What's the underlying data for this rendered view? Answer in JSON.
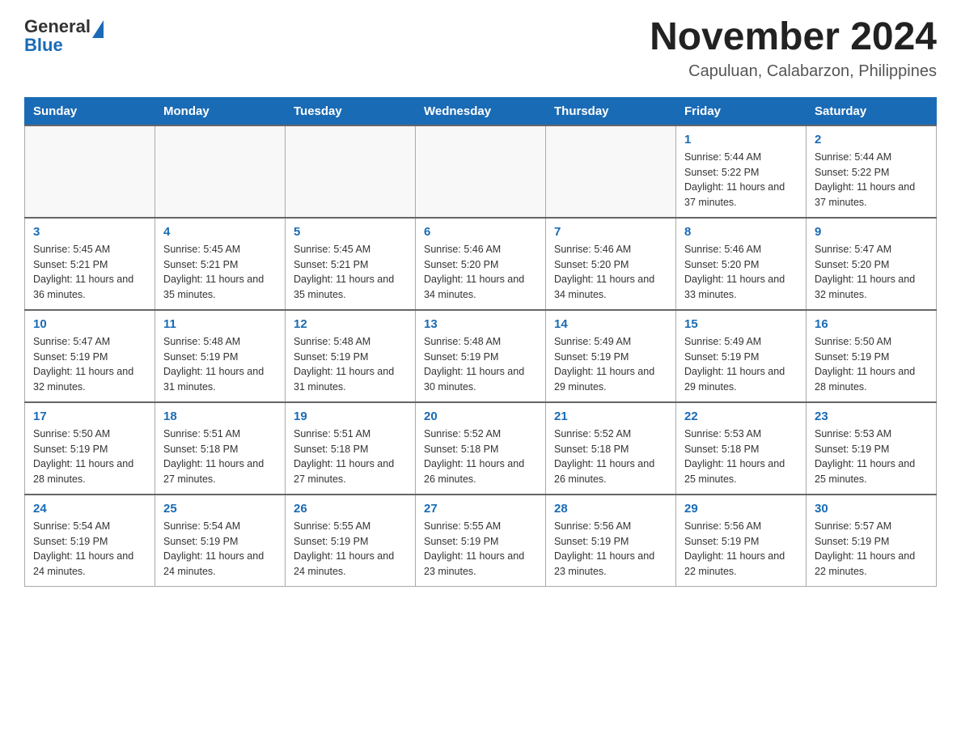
{
  "header": {
    "logo_general": "General",
    "logo_blue": "Blue",
    "title": "November 2024",
    "subtitle": "Capuluan, Calabarzon, Philippines"
  },
  "days_of_week": [
    "Sunday",
    "Monday",
    "Tuesday",
    "Wednesday",
    "Thursday",
    "Friday",
    "Saturday"
  ],
  "weeks": [
    [
      {
        "day": "",
        "info": ""
      },
      {
        "day": "",
        "info": ""
      },
      {
        "day": "",
        "info": ""
      },
      {
        "day": "",
        "info": ""
      },
      {
        "day": "",
        "info": ""
      },
      {
        "day": "1",
        "info": "Sunrise: 5:44 AM\nSunset: 5:22 PM\nDaylight: 11 hours and 37 minutes."
      },
      {
        "day": "2",
        "info": "Sunrise: 5:44 AM\nSunset: 5:22 PM\nDaylight: 11 hours and 37 minutes."
      }
    ],
    [
      {
        "day": "3",
        "info": "Sunrise: 5:45 AM\nSunset: 5:21 PM\nDaylight: 11 hours and 36 minutes."
      },
      {
        "day": "4",
        "info": "Sunrise: 5:45 AM\nSunset: 5:21 PM\nDaylight: 11 hours and 35 minutes."
      },
      {
        "day": "5",
        "info": "Sunrise: 5:45 AM\nSunset: 5:21 PM\nDaylight: 11 hours and 35 minutes."
      },
      {
        "day": "6",
        "info": "Sunrise: 5:46 AM\nSunset: 5:20 PM\nDaylight: 11 hours and 34 minutes."
      },
      {
        "day": "7",
        "info": "Sunrise: 5:46 AM\nSunset: 5:20 PM\nDaylight: 11 hours and 34 minutes."
      },
      {
        "day": "8",
        "info": "Sunrise: 5:46 AM\nSunset: 5:20 PM\nDaylight: 11 hours and 33 minutes."
      },
      {
        "day": "9",
        "info": "Sunrise: 5:47 AM\nSunset: 5:20 PM\nDaylight: 11 hours and 32 minutes."
      }
    ],
    [
      {
        "day": "10",
        "info": "Sunrise: 5:47 AM\nSunset: 5:19 PM\nDaylight: 11 hours and 32 minutes."
      },
      {
        "day": "11",
        "info": "Sunrise: 5:48 AM\nSunset: 5:19 PM\nDaylight: 11 hours and 31 minutes."
      },
      {
        "day": "12",
        "info": "Sunrise: 5:48 AM\nSunset: 5:19 PM\nDaylight: 11 hours and 31 minutes."
      },
      {
        "day": "13",
        "info": "Sunrise: 5:48 AM\nSunset: 5:19 PM\nDaylight: 11 hours and 30 minutes."
      },
      {
        "day": "14",
        "info": "Sunrise: 5:49 AM\nSunset: 5:19 PM\nDaylight: 11 hours and 29 minutes."
      },
      {
        "day": "15",
        "info": "Sunrise: 5:49 AM\nSunset: 5:19 PM\nDaylight: 11 hours and 29 minutes."
      },
      {
        "day": "16",
        "info": "Sunrise: 5:50 AM\nSunset: 5:19 PM\nDaylight: 11 hours and 28 minutes."
      }
    ],
    [
      {
        "day": "17",
        "info": "Sunrise: 5:50 AM\nSunset: 5:19 PM\nDaylight: 11 hours and 28 minutes."
      },
      {
        "day": "18",
        "info": "Sunrise: 5:51 AM\nSunset: 5:18 PM\nDaylight: 11 hours and 27 minutes."
      },
      {
        "day": "19",
        "info": "Sunrise: 5:51 AM\nSunset: 5:18 PM\nDaylight: 11 hours and 27 minutes."
      },
      {
        "day": "20",
        "info": "Sunrise: 5:52 AM\nSunset: 5:18 PM\nDaylight: 11 hours and 26 minutes."
      },
      {
        "day": "21",
        "info": "Sunrise: 5:52 AM\nSunset: 5:18 PM\nDaylight: 11 hours and 26 minutes."
      },
      {
        "day": "22",
        "info": "Sunrise: 5:53 AM\nSunset: 5:18 PM\nDaylight: 11 hours and 25 minutes."
      },
      {
        "day": "23",
        "info": "Sunrise: 5:53 AM\nSunset: 5:19 PM\nDaylight: 11 hours and 25 minutes."
      }
    ],
    [
      {
        "day": "24",
        "info": "Sunrise: 5:54 AM\nSunset: 5:19 PM\nDaylight: 11 hours and 24 minutes."
      },
      {
        "day": "25",
        "info": "Sunrise: 5:54 AM\nSunset: 5:19 PM\nDaylight: 11 hours and 24 minutes."
      },
      {
        "day": "26",
        "info": "Sunrise: 5:55 AM\nSunset: 5:19 PM\nDaylight: 11 hours and 24 minutes."
      },
      {
        "day": "27",
        "info": "Sunrise: 5:55 AM\nSunset: 5:19 PM\nDaylight: 11 hours and 23 minutes."
      },
      {
        "day": "28",
        "info": "Sunrise: 5:56 AM\nSunset: 5:19 PM\nDaylight: 11 hours and 23 minutes."
      },
      {
        "day": "29",
        "info": "Sunrise: 5:56 AM\nSunset: 5:19 PM\nDaylight: 11 hours and 22 minutes."
      },
      {
        "day": "30",
        "info": "Sunrise: 5:57 AM\nSunset: 5:19 PM\nDaylight: 11 hours and 22 minutes."
      }
    ]
  ]
}
